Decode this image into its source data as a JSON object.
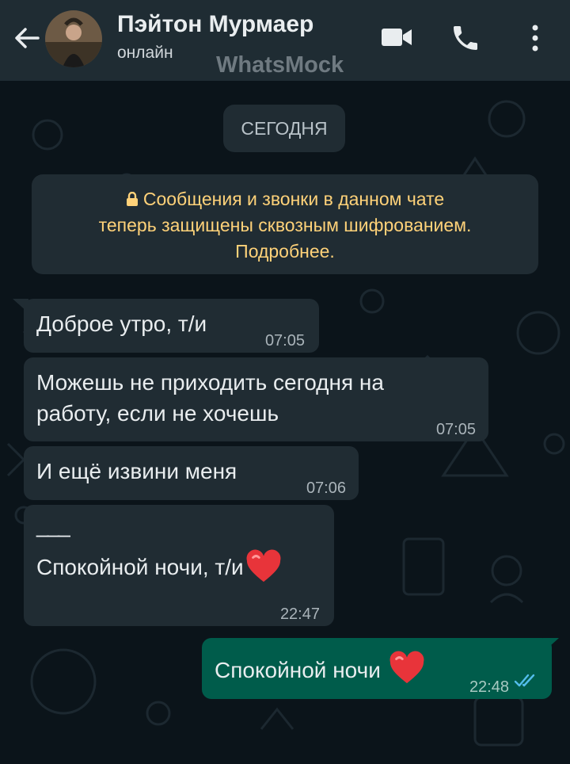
{
  "header": {
    "contact_name": "Пэйтон Мурмаер",
    "status": "онлайн",
    "watermark": "WhatsMock",
    "icons": [
      "back-arrow-icon",
      "video-call-icon",
      "phone-icon",
      "more-vert-icon"
    ]
  },
  "date_pill": "СЕГОДНЯ",
  "system_notice": {
    "icon": "lock-icon",
    "line1": "Сообщения и звонки в данном чате",
    "line2": "теперь защищены сквозным шифрованием.",
    "line3": "Подробнее."
  },
  "messages": [
    {
      "direction": "in",
      "line1": "Доброе утро, т/и",
      "time": "07:05"
    },
    {
      "direction": "in",
      "line1": "Можешь не приходить сегодня на",
      "line2": "работу, если не хочешь",
      "time": "07:05"
    },
    {
      "direction": "in",
      "line1": "И ещё извини меня",
      "time": "07:06"
    },
    {
      "direction": "in",
      "line1": "___",
      "line2": "Спокойной ночи, т/и",
      "emoji": "heart-emoji",
      "time": "22:47"
    },
    {
      "direction": "out",
      "line1": "Спокойной ночи",
      "emoji": "heart-emoji",
      "time": "22:48",
      "status": "read-double-check-icon"
    }
  ],
  "colors": {
    "header_bg": "#1f2c33",
    "chat_bg": "#0b141a",
    "incoming_bubble": "#202c33",
    "outgoing_bubble": "#005c4b",
    "notice_text": "#ffd279",
    "read_check": "#53bdeb"
  }
}
